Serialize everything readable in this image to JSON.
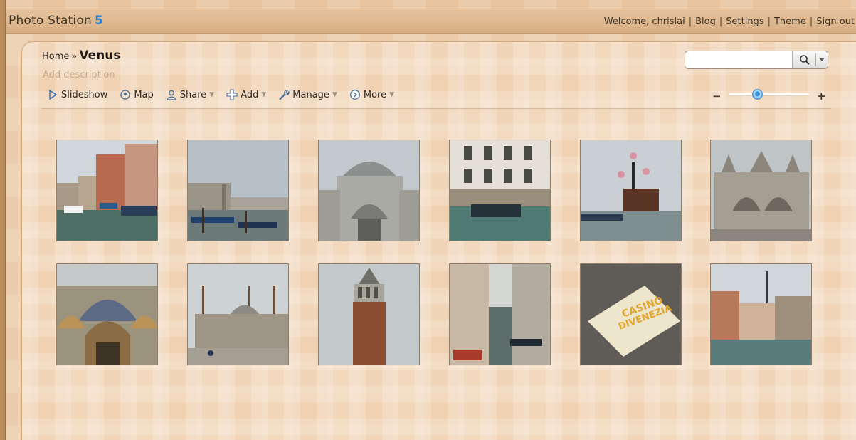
{
  "app": {
    "logo_text": "Photo Station",
    "logo_version": "5"
  },
  "header": {
    "welcome": "Welcome, chrislai",
    "links": [
      "Blog",
      "Settings",
      "Theme",
      "Sign out"
    ]
  },
  "breadcrumb": {
    "home": "Home",
    "separator": "»",
    "current": "Venus"
  },
  "album": {
    "description_placeholder": "Add description"
  },
  "toolbar": {
    "slideshow": "Slideshow",
    "map": "Map",
    "share": "Share",
    "add": "Add",
    "manage": "Manage",
    "more": "More"
  },
  "search": {
    "value": "",
    "placeholder": ""
  },
  "zoom": {
    "minus": "−",
    "plus": "+",
    "level": 0.35
  },
  "photos": [
    {
      "subject": "canal-with-boats"
    },
    {
      "subject": "grand-canal-gondolas"
    },
    {
      "subject": "domed-church"
    },
    {
      "subject": "flooded-square-building"
    },
    {
      "subject": "lamp-post-kiosk"
    },
    {
      "subject": "basilica-facade"
    },
    {
      "subject": "basilica-mosaic-facade"
    },
    {
      "subject": "piazza-with-flagpoles"
    },
    {
      "subject": "bell-tower"
    },
    {
      "subject": "narrow-canal"
    },
    {
      "subject": "casino-di-venezia-sign"
    },
    {
      "subject": "canal-buildings"
    }
  ],
  "sign_text": {
    "line1": "CASINÒ",
    "line2": "DIVENEZIA"
  },
  "colors": {
    "accent": "#1f7fd6",
    "background": "#e8c49e"
  }
}
